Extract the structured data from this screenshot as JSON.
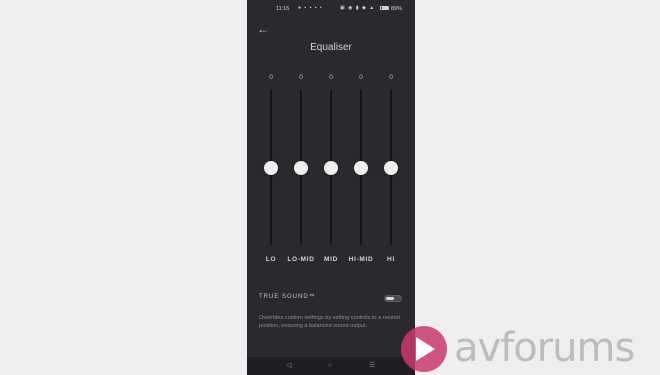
{
  "status_bar": {
    "time": "11:15",
    "notification_icons": "● ▪ ▪ ▪ •",
    "system_icons": "▣ ◉ ▮ ◆ ▲",
    "battery": "89%"
  },
  "header": {
    "back_icon": "arrow-left-icon",
    "title": "Equaliser"
  },
  "equaliser": {
    "bands": [
      {
        "label": "LO",
        "value": "0",
        "level": 0
      },
      {
        "label": "LO-MID",
        "value": "0",
        "level": 0
      },
      {
        "label": "MID",
        "value": "0",
        "level": 0
      },
      {
        "label": "HI-MID",
        "value": "0",
        "level": 0
      },
      {
        "label": "HI",
        "value": "0",
        "level": 0
      }
    ]
  },
  "true_sound": {
    "label": "TRUE SOUND™",
    "enabled": false,
    "description": "Overrides custom settings by setting controls to a neutral position, ensuring a balanced sound output."
  },
  "nav_bar": {
    "back": "◁",
    "home": "○",
    "recents": "☰"
  },
  "watermark": {
    "text": "avforums",
    "color": "#c83a6d"
  }
}
